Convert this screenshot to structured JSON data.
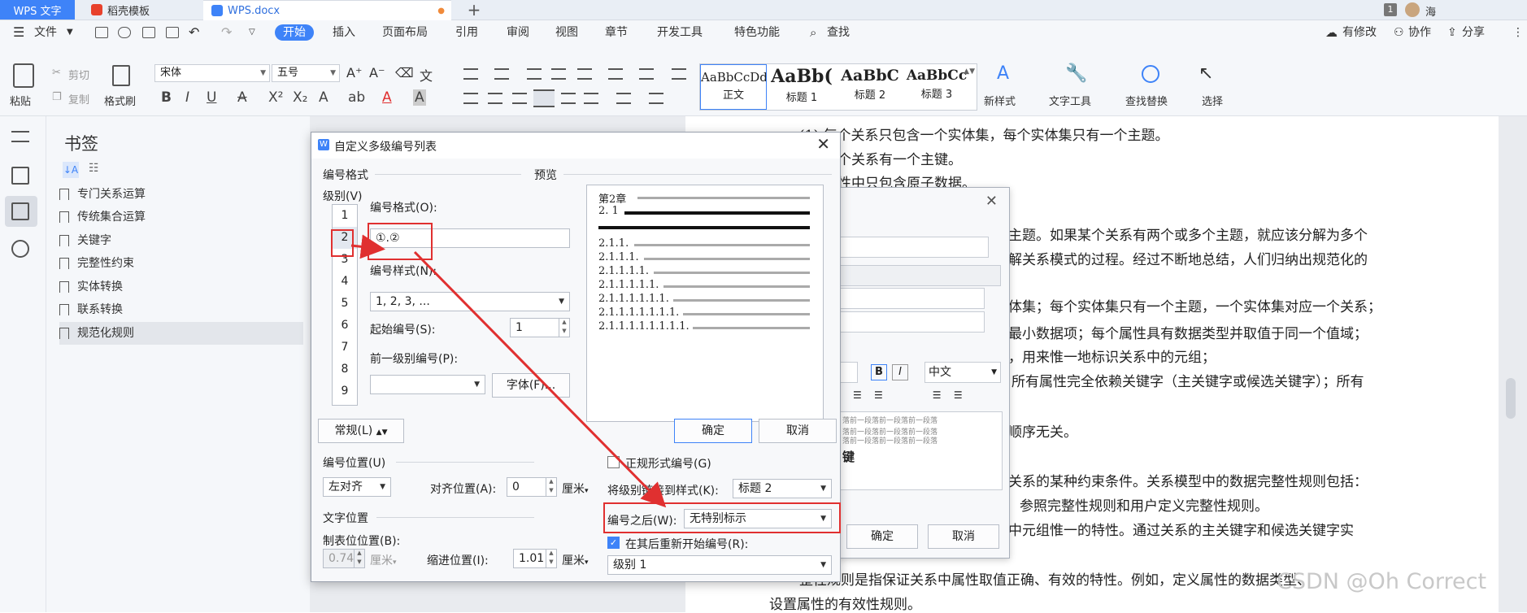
{
  "tabs": {
    "app": "WPS 文字",
    "template": "稻壳模板",
    "doc": "WPS.docx",
    "window_count": "1",
    "user": "海"
  },
  "menu": {
    "file": "文件",
    "start": "开始",
    "insert": "插入",
    "layout": "页面布局",
    "references": "引用",
    "review": "审阅",
    "view": "视图",
    "chapter": "章节",
    "devtools": "开发工具",
    "special": "特色功能",
    "search": "查找",
    "modified": "有修改",
    "collab": "协作",
    "share": "分享"
  },
  "ribbon": {
    "paste": "粘贴",
    "cut": "剪切",
    "copy": "复制",
    "format_painter": "格式刷",
    "font_name": "宋体",
    "font_size": "五号",
    "styles": [
      {
        "sample": "AaBbCcDd",
        "name": "正文"
      },
      {
        "sample": "AaBb(",
        "name": "标题 1"
      },
      {
        "sample": "AaBbC",
        "name": "标题 2"
      },
      {
        "sample": "AaBbCc",
        "name": "标题 3"
      }
    ],
    "new_style": "新样式",
    "text_tools": "文字工具",
    "find_replace": "查找替换",
    "select": "选择"
  },
  "bookmarks": {
    "title": "书签",
    "items": [
      "专门关系运算",
      "传统集合运算",
      "关键字",
      "完整性约束",
      "实体转换",
      "联系转换",
      "规范化规则"
    ]
  },
  "document": {
    "lines": [
      "(1) 每个关系只包含一个实体集，每个实体集只有一个主题。",
      "个关系有一个主键。",
      "性中只包含原子数据。",
      "主题。如果某个关系有两个或多个主题，就应该分解为多个",
      "解关系模式的过程。经过不断地总结，人们归纳出规范化的",
      "体集；每个实体集只有一个主题，一个实体集对应一个关系；",
      "最小数据项；每个属性具有数据类型并取值于同一个值域；",
      "，用来惟一地标识关系中的元组；",
      "所有属性完全依赖关键字（主关键字或候选关键字）；所有",
      "顺序无关。",
      "关系的某种约束条件。关系模型中的数据完整性规则包括：",
      "参照完整性规则和用户定义完整性规则。",
      "中元组惟一的特性。通过关系的主关键字和候选关键字实",
      "整性规则是指保证关系中属性取值正确、有效的特性。例如，定义属性的数据类型、",
      "设置属性的有效性规则。"
    ]
  },
  "para_dialog": {
    "lang": "中文",
    "bold": "B",
    "italic": "I",
    "preview_text": "落前一段落前一段落前一段落",
    "key_label": "键",
    "ok": "确定",
    "cancel": "取消"
  },
  "dialog": {
    "title": "自定义多级编号列表",
    "format_group": "编号格式",
    "preview_group": "预览",
    "level_label": "级别(V)",
    "levels": [
      "1",
      "2",
      "3",
      "4",
      "5",
      "6",
      "7",
      "8",
      "9"
    ],
    "selected_level": "2",
    "number_format_label": "编号格式(O):",
    "number_format_value": "①.②",
    "number_style_label": "编号样式(N):",
    "number_style_value": "1, 2, 3, ...",
    "start_label": "起始编号(S):",
    "start_value": "1",
    "prev_level_label": "前一级别编号(P):",
    "prev_level_value": "",
    "font_button": "字体(F)...",
    "preview_rows": [
      "第2章",
      "2. 1",
      "",
      "2.1.1.",
      "2.1.1.1.",
      "2.1.1.1.1.",
      "2.1.1.1.1.1.",
      "2.1.1.1.1.1.1.",
      "2.1.1.1.1.1.1.1.",
      "2.1.1.1.1.1.1.1.1."
    ],
    "ok": "确定",
    "cancel": "取消",
    "general_button": "常规(L)",
    "position_group": "编号位置(U)",
    "align_value": "左对齐",
    "align_pos_label": "对齐位置(A):",
    "align_pos_value": "0",
    "unit_cm": "厘米",
    "text_pos_group": "文字位置",
    "tab_pos_label": "制表位位置(B):",
    "tab_pos_value": "0.74",
    "indent_label": "缩进位置(I):",
    "indent_value": "1.01",
    "legal_label": "正规形式编号(G)",
    "link_style_label": "将级别链接到样式(K):",
    "link_style_value": "标题 2",
    "after_number_label": "编号之后(W):",
    "after_number_value": "无特别标示",
    "restart_label": "在其后重新开始编号(R):",
    "restart_value": "级别 1"
  },
  "watermark": "CSDN @Oh Correct",
  "colors": {
    "accent": "#3e83f8",
    "annotation": "#e03030"
  }
}
